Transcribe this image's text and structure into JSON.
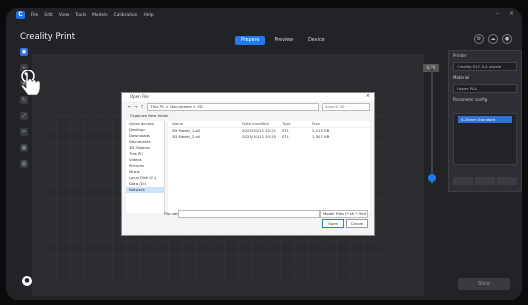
{
  "menubar": {
    "logo": "C",
    "items": [
      "File",
      "Edit",
      "View",
      "Tools",
      "Models",
      "Calibration",
      "Help"
    ]
  },
  "app": {
    "title": "Creality Print"
  },
  "tabs": [
    {
      "label": "Prepare",
      "active": true
    },
    {
      "label": "Preview",
      "active": false
    },
    {
      "label": "Device",
      "active": false
    }
  ],
  "right_panel": {
    "printer_heading": "Printer",
    "printer_value": "Creality K1C 0.4 nozzle",
    "material_heading": "Material",
    "material_value": "Hyper PLA",
    "process_heading": "Parameter config",
    "process_value": "0.20mm Standard"
  },
  "slice_button": "Slice",
  "slider_top": "0.20",
  "dialog": {
    "title": "Open File",
    "address": "This PC > Documents > 3D",
    "search_placeholder": "Search 3D",
    "toolbar": "Organize    New folder",
    "nav_items": [
      "Quick access",
      "Desktop",
      "Downloads",
      "Documents",
      "3D Objects",
      "This PC",
      "Videos",
      "Pictures",
      "Music",
      "Local Disk (C:)",
      "Data (D:)",
      "Network"
    ],
    "columns": [
      "Name",
      "Date modified",
      "Type",
      "Size"
    ],
    "files": [
      {
        "name": "3D Model_1.stl",
        "date": "2023/10/12 10:21",
        "type": "STL",
        "size": "2,215 KB"
      },
      {
        "name": "3D Model_2.stl",
        "date": "2023/10/12 10:25",
        "type": "STL",
        "size": "1,307 KB"
      }
    ],
    "filename_label": "File name:",
    "filetype": "Model Files (*.stl *.3mf *.obj)",
    "open_label": "Open",
    "cancel_label": "Cancel"
  },
  "window_controls": {
    "minimize": "–",
    "maximize": "□",
    "close": "×"
  }
}
